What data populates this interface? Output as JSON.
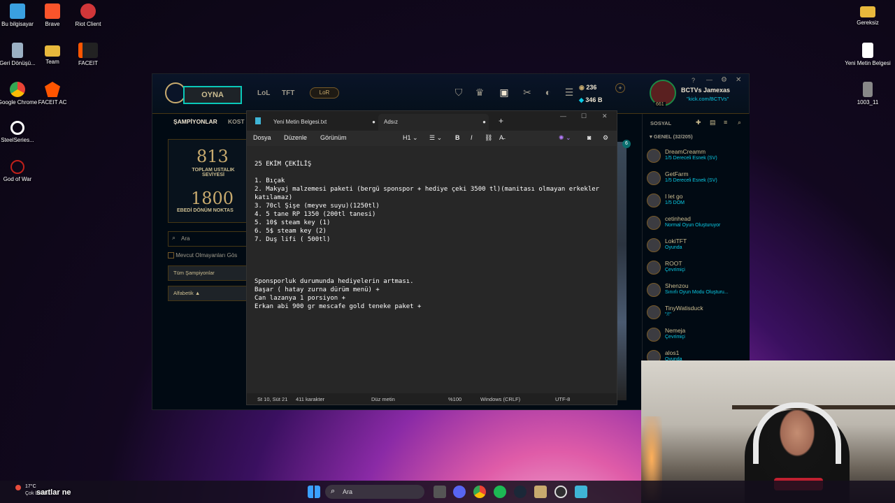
{
  "desktop": {
    "icons": [
      {
        "label": "Bu bilgisayar",
        "color": "#3aa0e0"
      },
      {
        "label": "Brave",
        "color": "#fb542b"
      },
      {
        "label": "Riot Client",
        "color": "#d13639"
      },
      {
        "label": "Geri Dönüşü...",
        "color": "#9bb0c4"
      },
      {
        "label": "Team",
        "color": "#e8b83c"
      },
      {
        "label": "FACEIT",
        "color": "#ff5500"
      },
      {
        "label": "Google Chrome",
        "color": "#34a853"
      },
      {
        "label": "FACEIT AC",
        "color": "#ff5500"
      },
      {
        "label": "SteelSeries...",
        "color": "#ffffff"
      },
      {
        "label": "God of War",
        "color": "#c0201a"
      },
      {
        "label": "Gereksiz",
        "color": "#e8b83c"
      },
      {
        "label": "Yeni Metin Belgesi",
        "color": "#ffffff"
      },
      {
        "label": "1003_11",
        "color": "#888888"
      }
    ]
  },
  "lol": {
    "play_label": "OYNA",
    "nav": [
      "LoL",
      "TFT"
    ],
    "lor_label": "LoR",
    "currency_be": "236",
    "currency_rp": "346 B",
    "profile_name": "BCTVs Jamexas",
    "profile_status": "\"kick.com/BCTVs\"",
    "profile_level": "661",
    "tabs": [
      "ŞAMPİYONLAR",
      "KOST"
    ],
    "mastery_value": "813",
    "mastery_label": "TOPLAM USTALIK SEVİYESİ",
    "eternal_value": "1800",
    "eternal_label": "EBEDİ DÖNÜM NOKTAS",
    "search_placeholder": "Ara",
    "unavailable_label": "Mevcut Olmayanları Gös",
    "filter_all": "Tüm Şampiyonlar",
    "sort_label": "Alfabetik ▲",
    "social_label": "SOSYAL",
    "group_label": "GENEL (32/205)",
    "badge_count": "6",
    "friends": [
      {
        "name": "DreamCreamm",
        "status": "1/5 Dereceli Esnek (SV)"
      },
      {
        "name": "GetFarm",
        "status": "1/5 Dereceli Esnek (SV)"
      },
      {
        "name": "I let go",
        "status": "1/5 DOM"
      },
      {
        "name": "cetinhead",
        "status": "Normal Oyun Oluşturuyor"
      },
      {
        "name": "LokiTFT",
        "status": "Oyunda"
      },
      {
        "name": "ROOT",
        "status": "Çevrimiçi"
      },
      {
        "name": "Shenzou",
        "status": "Sınırlı Oyun Modu Oluşturu..."
      },
      {
        "name": "TinyWatisduck",
        "status": "\"/!\""
      },
      {
        "name": "Nemeja",
        "status": "Çevrimiçi"
      },
      {
        "name": "alos1",
        "status": "Oyunda"
      }
    ]
  },
  "notepad": {
    "tab1": "Yeni Metin Belgesi.txt",
    "tab2": "Adsız",
    "menus": [
      "Dosya",
      "Düzenle",
      "Görünüm"
    ],
    "heading": "H1",
    "lines": [
      "25 EKİM ÇEKİLİŞ",
      "",
      "1. Bıçak",
      "2. Makyaj malzemesi paketi (bergü sponspor + hediye çeki 3500 tl)(manitası olmayan erkekler",
      "katılamaz)",
      "3. 70cl Şişe (meyve suyu)(1250tl)",
      "4. 5 tane RP 1350 (200tl tanesi)",
      "5. 10$ steam key (1)",
      "6. 5$ steam key (2)",
      "7. Duş lifi ( 500tl)",
      "",
      "",
      "",
      "",
      "Sponsporluk durumunda hediyelerin artması.",
      "Başar ( hatay zurna dürüm menü) +",
      "Can lazanya 1 porsiyon +",
      "Erkan abi 900 gr mescafe gold teneke paket +"
    ],
    "status": {
      "pos": "St 10, Süt 21",
      "chars": "411 karakter",
      "format": "Düz metin",
      "zoom": "%100",
      "eol": "Windows (CRLF)",
      "enc": "UTF-8"
    }
  },
  "taskbar": {
    "search": "Ara",
    "weather_temp": "17°C",
    "weather_desc": "Çok bulutlu",
    "overlay_text": "sartlar ne"
  }
}
